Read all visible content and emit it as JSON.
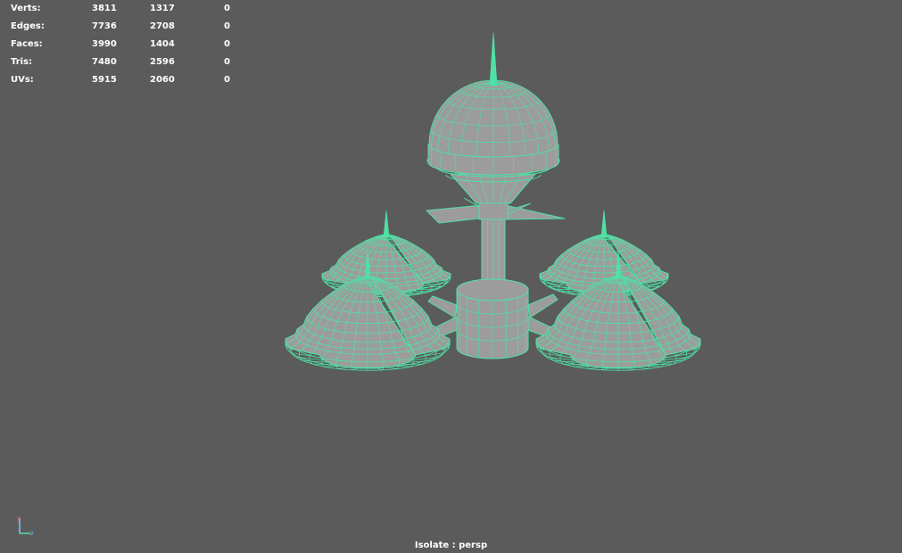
{
  "hud": {
    "rows": [
      {
        "label": "Verts:",
        "c1": "3811",
        "c2": "1317",
        "c3": "0"
      },
      {
        "label": "Edges:",
        "c1": "7736",
        "c2": "2708",
        "c3": "0"
      },
      {
        "label": "Faces:",
        "c1": "3990",
        "c2": "1404",
        "c3": "0"
      },
      {
        "label": "Tris:",
        "c1": "7480",
        "c2": "2596",
        "c3": "0"
      },
      {
        "label": "UVs:",
        "c1": "5915",
        "c2": "2060",
        "c3": "0"
      }
    ]
  },
  "viewport": {
    "camera_label": "Isolate : persp",
    "background_color": "#5b5b5b",
    "wireframe_color": "#4fe0a6",
    "mesh_fill_color": "#9c9c9c"
  },
  "axis_gizmo": {
    "y_label": "y",
    "z_label": "z"
  }
}
